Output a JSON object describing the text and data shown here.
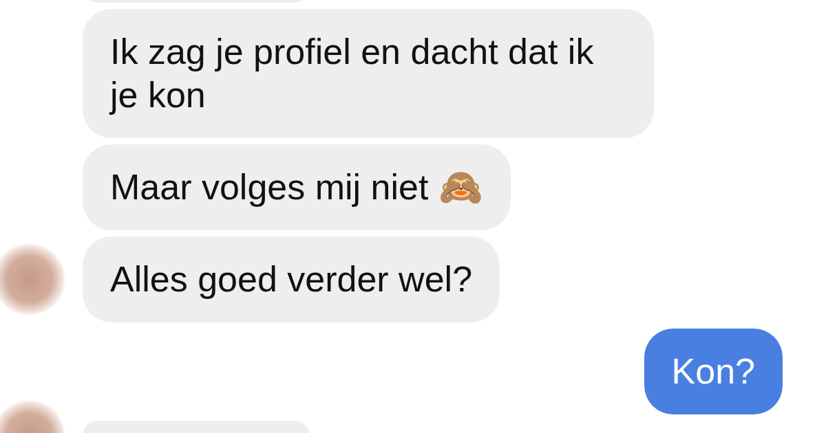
{
  "messages": [
    {
      "kind": "received",
      "avatar": false
    },
    {
      "kind": "received",
      "avatar": false,
      "text": "Ik zag je profiel en dacht dat ik je kon"
    },
    {
      "kind": "received",
      "avatar": false,
      "text": "Maar volges mij niet 🙈"
    },
    {
      "kind": "received",
      "avatar": true,
      "text": "Alles goed verder wel?"
    },
    {
      "kind": "sent",
      "avatar": false,
      "text": "Kon?"
    },
    {
      "kind": "received",
      "avatar": true
    }
  ]
}
